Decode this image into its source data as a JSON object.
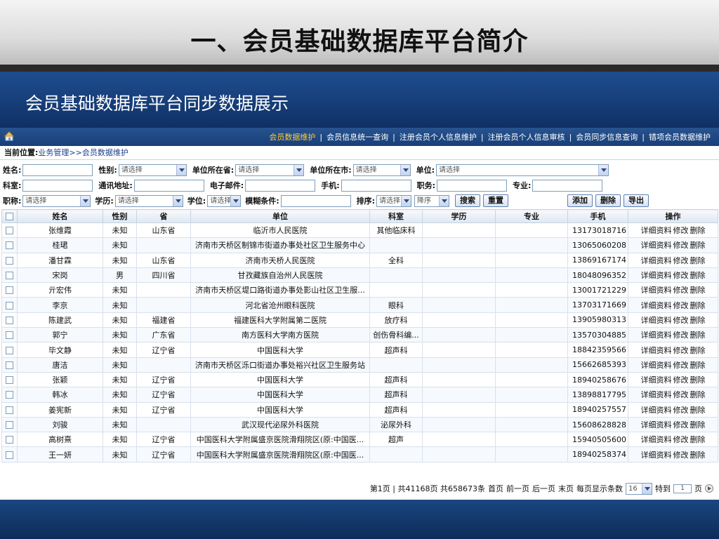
{
  "slide": {
    "title": "一、会员基础数据库平台简介",
    "subtitle": "会员基础数据库平台同步数据展示"
  },
  "nav": {
    "items": [
      "会员数据维护",
      "会员信息统一查询",
      "注册会员个人信息维护",
      "注册会员个人信息审核",
      "会员同步信息查询",
      "错项会员数据维护"
    ],
    "active_index": 0,
    "separator": "|"
  },
  "breadcrumb": {
    "label": "当前位置:",
    "path": "业务管理>>会员数据维护"
  },
  "filters": {
    "name_label": "姓名:",
    "gender_label": "性别:",
    "gender_value": "请选择",
    "province_label": "单位所在省:",
    "province_value": "请选择",
    "city_label": "单位所在市:",
    "city_value": "请选择",
    "unit_label": "单位:",
    "unit_value": "请选择",
    "dept_label": "科室:",
    "address_label": "通讯地址:",
    "email_label": "电子邮件:",
    "phone_label": "手机:",
    "position_label": "职务:",
    "major_label": "专业:",
    "title_label": "职称:",
    "title_value": "请选择",
    "edu_label": "学历:",
    "edu_value": "请选择",
    "degree_label": "学位:",
    "degree_value": "请选择",
    "fuzzy_label": "模糊条件:",
    "sort_label": "排序:",
    "sort_value": "请选择",
    "order_value": "降序",
    "search_button": "搜索",
    "reset_button": "重置",
    "add_button": "添加",
    "delete_button": "删除",
    "export_button": "导出"
  },
  "table": {
    "headers": [
      "姓名",
      "性别",
      "省",
      "单位",
      "科室",
      "学历",
      "专业",
      "手机",
      "操作"
    ],
    "actions": [
      "详细资料",
      "修改",
      "删除"
    ],
    "rows": [
      [
        "张维霞",
        "未知",
        "山东省",
        "临沂市人民医院",
        "其他临床科",
        "",
        "",
        "13173018716"
      ],
      [
        "桂珺",
        "未知",
        "",
        "济南市天桥区制锦市街道办事处社区卫生服务中心",
        "",
        "",
        "",
        "13065060208"
      ],
      [
        "潘甘霖",
        "未知",
        "山东省",
        "济南市天桥人民医院",
        "全科",
        "",
        "",
        "13869167174"
      ],
      [
        "宋岗",
        "男",
        "四川省",
        "甘孜藏族自治州人民医院",
        "",
        "",
        "",
        "18048096352"
      ],
      [
        "亓宏伟",
        "未知",
        "",
        "济南市天桥区堤口路街道办事处影山社区卫生服...",
        "",
        "",
        "",
        "13001721229"
      ],
      [
        "李京",
        "未知",
        "",
        "河北省沧州眼科医院",
        "眼科",
        "",
        "",
        "13703171669"
      ],
      [
        "陈建武",
        "未知",
        "福建省",
        "福建医科大学附属第二医院",
        "放疗科",
        "",
        "",
        "13905980313"
      ],
      [
        "郭宁",
        "未知",
        "广东省",
        "南方医科大学南方医院",
        "创伤骨科编...",
        "",
        "",
        "13570304885"
      ],
      [
        "毕文静",
        "未知",
        "辽宁省",
        "中国医科大学",
        "超声科",
        "",
        "",
        "18842359566"
      ],
      [
        "唐洁",
        "未知",
        "",
        "济南市天桥区泺口街道办事处裕兴社区卫生服务站",
        "",
        "",
        "",
        "15662685393"
      ],
      [
        "张颖",
        "未知",
        "辽宁省",
        "中国医科大学",
        "超声科",
        "",
        "",
        "18940258676"
      ],
      [
        "韩冰",
        "未知",
        "辽宁省",
        "中国医科大学",
        "超声科",
        "",
        "",
        "13898817795"
      ],
      [
        "姜宪新",
        "未知",
        "辽宁省",
        "中国医科大学",
        "超声科",
        "",
        "",
        "18940257557"
      ],
      [
        "刘骏",
        "未知",
        "",
        "武汉现代泌尿外科医院",
        "泌尿外科",
        "",
        "",
        "15608628828"
      ],
      [
        "高树熹",
        "未知",
        "辽宁省",
        "中国医科大学附属盛京医院滑翔院区(原:中国医...",
        "超声",
        "",
        "",
        "15940505600"
      ],
      [
        "王一妍",
        "未知",
        "辽宁省",
        "中国医科大学附属盛京医院滑翔院区(原:中国医...",
        "",
        "",
        "",
        "18940258374"
      ]
    ]
  },
  "pager": {
    "summary": "第1页 | 共41168页 共658673条",
    "first": "首页",
    "prev": "前一页",
    "next": "后一页",
    "last": "末页",
    "per_page_label": "每页显示条数",
    "per_page_value": "16",
    "goto_label": "特到",
    "goto_value": "1",
    "page_suffix": "页"
  }
}
